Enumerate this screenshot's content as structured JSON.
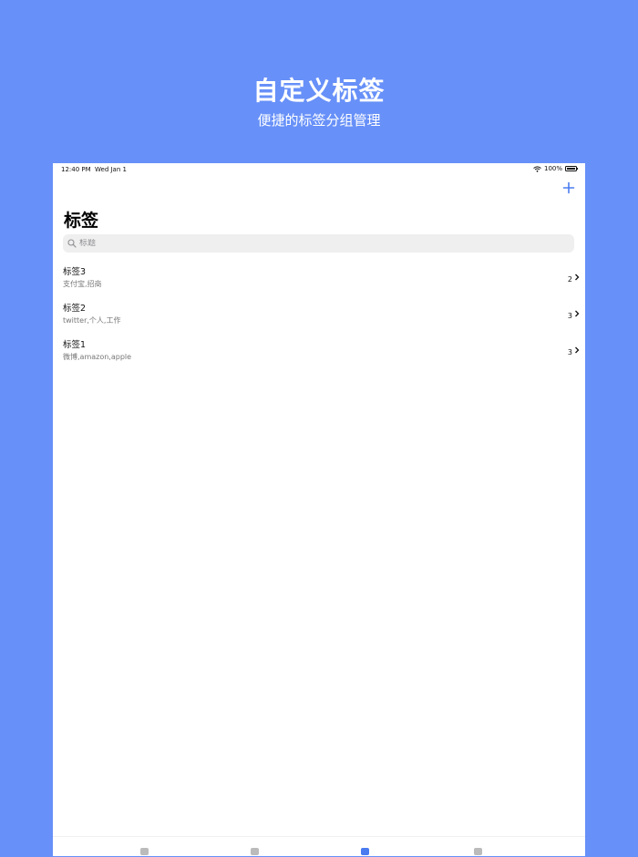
{
  "hero": {
    "title": "自定义标签",
    "subtitle": "便捷的标签分组管理"
  },
  "status_bar": {
    "time": "12:40 PM",
    "date": "Wed Jan 1",
    "battery": "100%"
  },
  "nav": {
    "add_icon": "plus-icon",
    "title": "标签"
  },
  "search": {
    "placeholder": "标题",
    "value": ""
  },
  "tags": [
    {
      "name": "标签3",
      "items": "支付宝,招商",
      "count": "2"
    },
    {
      "name": "标签2",
      "items": "twitter,个人,工作",
      "count": "3"
    },
    {
      "name": "标签1",
      "items": "微博,amazon,apple",
      "count": "3"
    }
  ],
  "tab_bar": {
    "tabs": [
      {
        "label": "",
        "active": false
      },
      {
        "label": "",
        "active": false
      },
      {
        "label": "",
        "active": true
      },
      {
        "label": "",
        "active": false
      }
    ]
  },
  "colors": {
    "background": "#6790f8",
    "accent": "#4a7cf0"
  }
}
